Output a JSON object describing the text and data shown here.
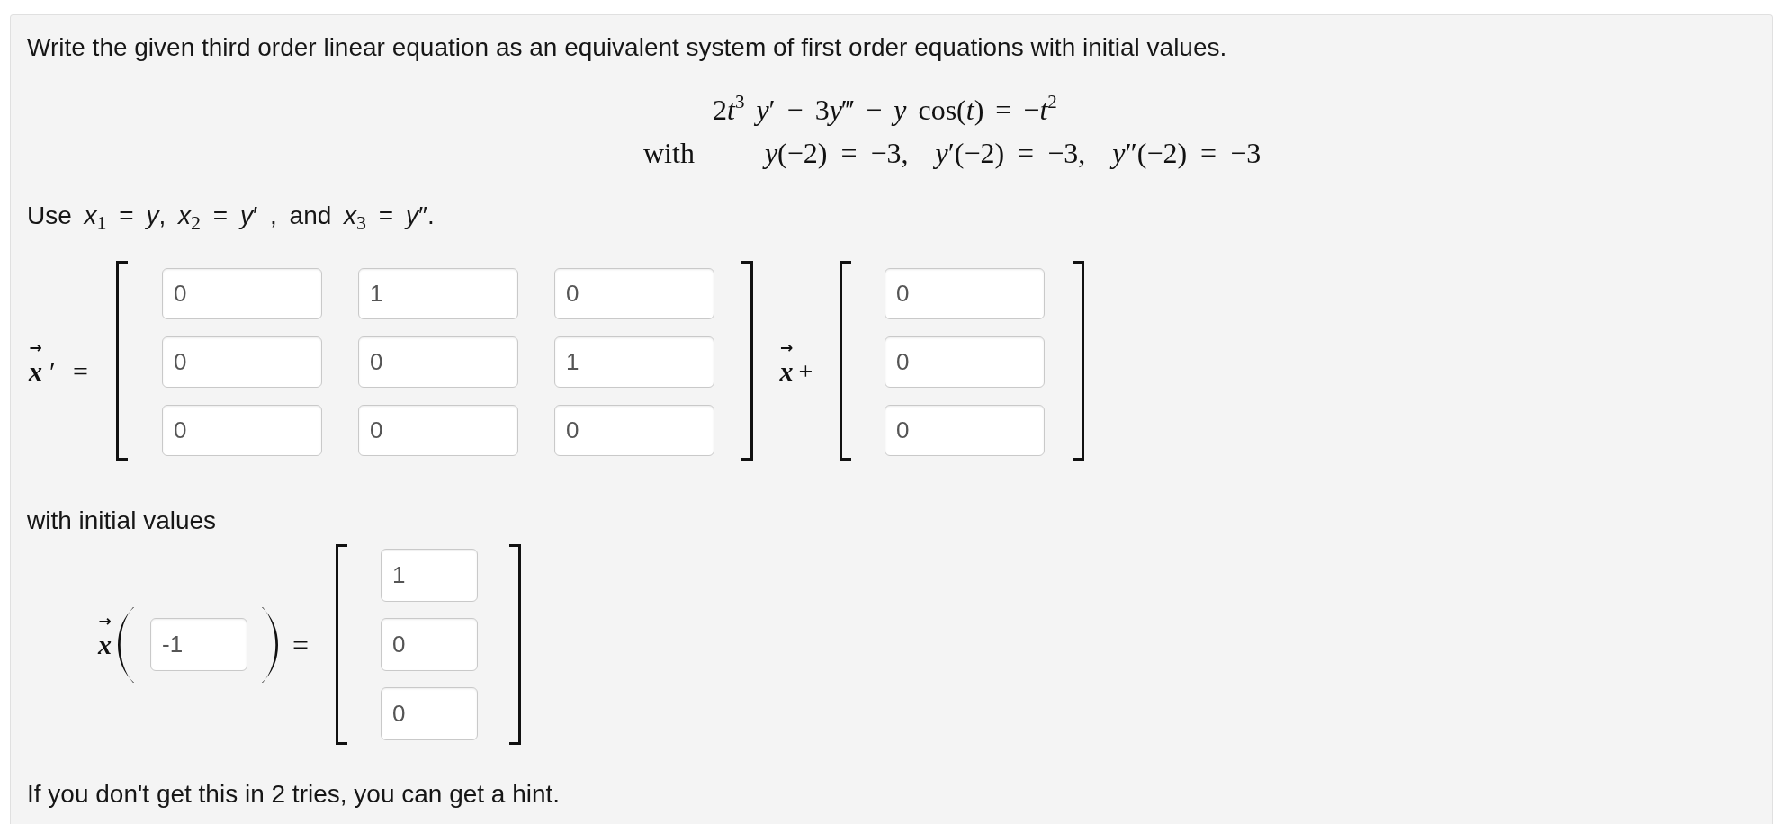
{
  "instructions": "Write the given third order linear equation as an equivalent system of first order equations with initial values.",
  "problem": {
    "equation_parts": [
      "2",
      "*t*$^{3}$ *y*′ − ",
      "3",
      "*y*‴ − *y* cos(*t*) = −*t*$^{2}$"
    ],
    "with_label": "with",
    "initial_conditions": [
      "*y*(−2) = −3,",
      "*y*′(−2) = −3,",
      "*y*″(−2) = −3"
    ]
  },
  "substitution": "Use *x*$_{1}$ = *y*, *x*$_{2}$ = *y*′ , and *x*$_{3}$ = *y*″.",
  "system": {
    "lhs": {
      "arrow": "→",
      "symbol": "x",
      "suffix": "′ ="
    },
    "matrix": [
      [
        "0",
        "1",
        "0"
      ],
      [
        "0",
        "0",
        "1"
      ],
      [
        "0",
        "0",
        "0"
      ]
    ],
    "middle": {
      "arrow": "→",
      "symbol": "x",
      "suffix": "+"
    },
    "vector": [
      "0",
      "0",
      "0"
    ]
  },
  "initial_label": "with initial values",
  "initial": {
    "arrow": "→",
    "symbol": "x",
    "time": "-1",
    "equals": "=",
    "vector": [
      "1",
      "0",
      "0"
    ]
  },
  "hint": "If you don't get this in 2 tries, you can get a hint."
}
